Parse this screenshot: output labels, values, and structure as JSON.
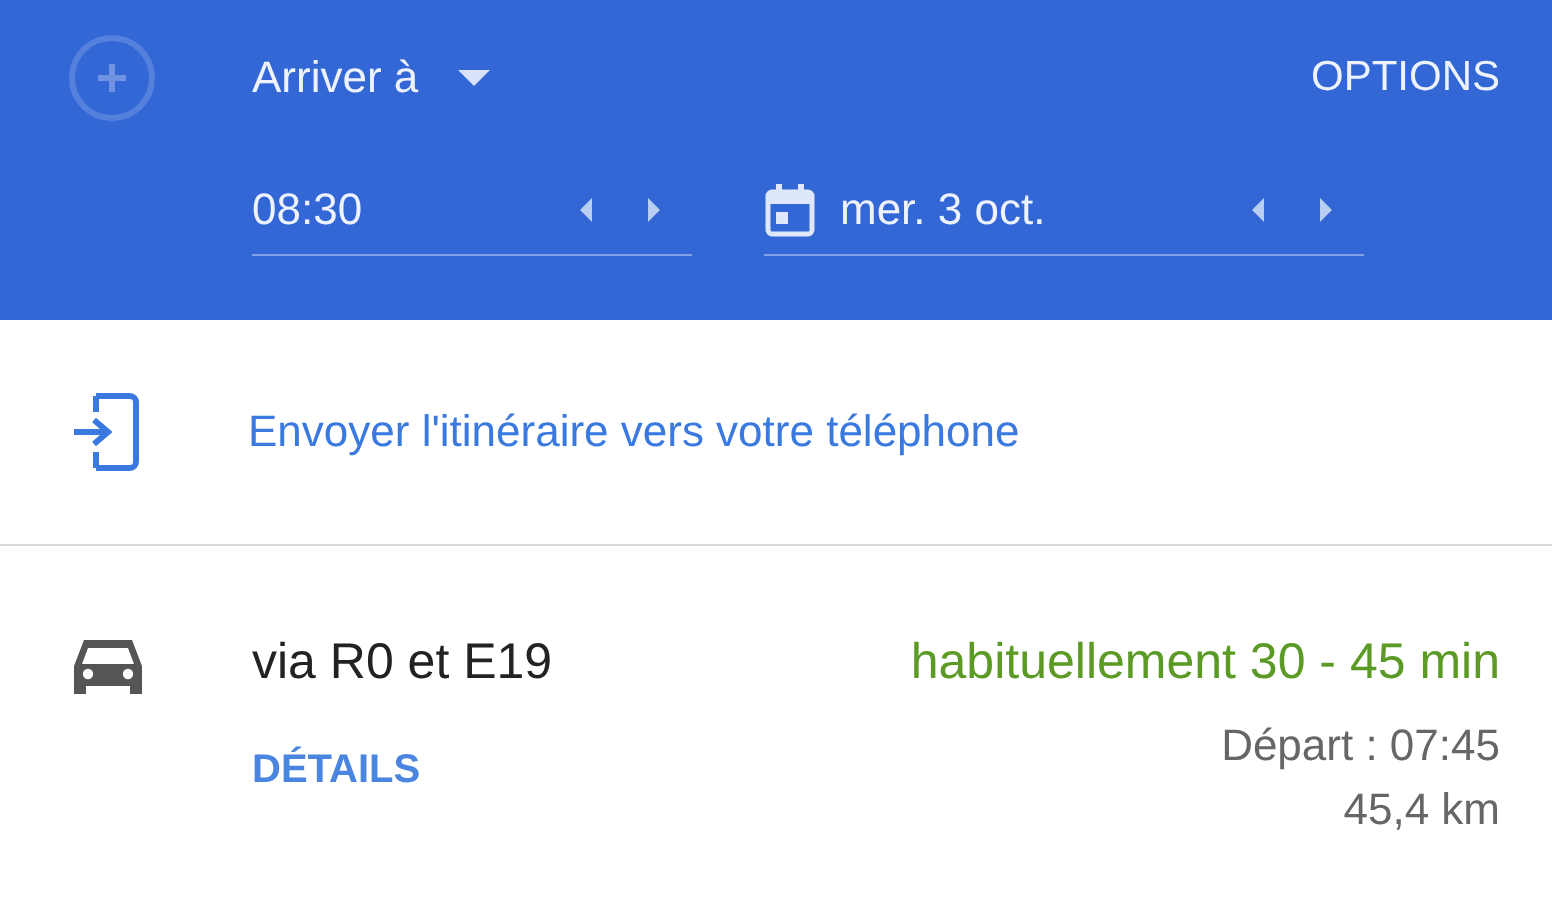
{
  "header": {
    "mode_label": "Arriver à",
    "options_label": "OPTIONS",
    "time_field": {
      "value": "08:30"
    },
    "date_field": {
      "value": "mer. 3 oct."
    }
  },
  "send_to_phone": {
    "label": "Envoyer l'itinéraire vers votre téléphone"
  },
  "route": {
    "kind": "car",
    "via": "via R0 et E19",
    "duration": "habituellement 30 - 45 min",
    "details_label": "DÉTAILS",
    "departure": "Départ : 07:45",
    "distance": "45,4 km"
  }
}
